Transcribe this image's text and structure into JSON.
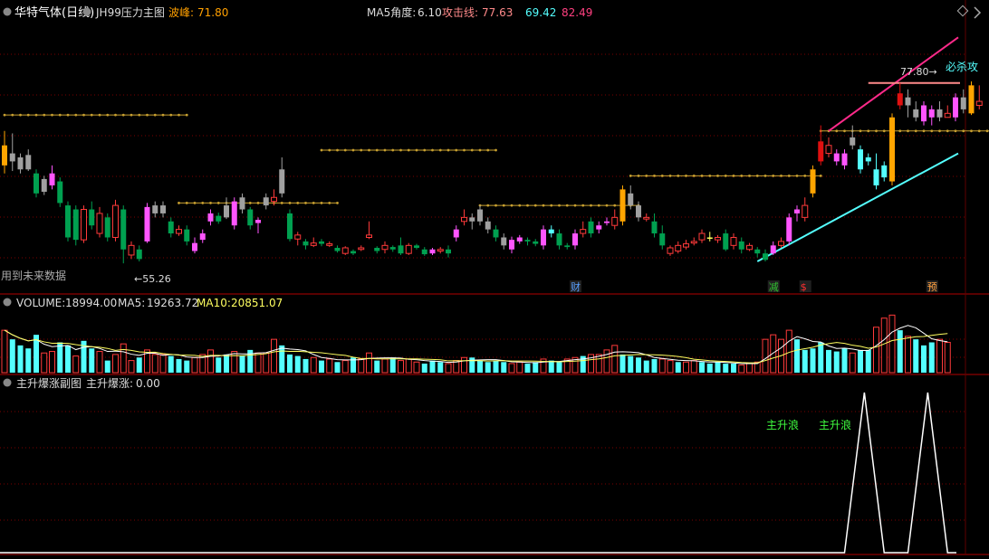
{
  "colors": {
    "up": "#ff3a3a",
    "down": "#00a050",
    "pink": "#ff55ff",
    "gray": "#a0a0a0",
    "cyan": "#54ffff",
    "orange": "#ffa500",
    "gold": "#c8a030",
    "grid": "#7a0000",
    "yellow": "#ffff60",
    "white": "#ffffff",
    "magenta": "#ff2a8a",
    "salmon": "#ff8a8a"
  },
  "main_panel": {
    "title_name": "华特气体(日线)",
    "indicator_name": "JH99压力主图",
    "wave_peak_label": "波峰:",
    "wave_peak_value": "71.80",
    "ma5_angle_label": "MA5角度:",
    "ma5_angle_value": "6.10",
    "attack_line_label": "攻击线:",
    "attack_line_value": "77.63",
    "value_2": "69.42",
    "value_3": "82.49",
    "future_note": "用到未来数据",
    "low_marker": "←55.26",
    "high_marker": "77.80→",
    "kill_signal": "必杀攻",
    "events": [
      {
        "text": "财",
        "index": 72,
        "color": "#5aa0ff"
      },
      {
        "text": "减",
        "index": 97,
        "color": "#30c030"
      },
      {
        "text": "$",
        "index": 101,
        "color": "#ff3030"
      },
      {
        "text": "预",
        "index": 117,
        "color": "#ffa040"
      }
    ]
  },
  "volume_panel": {
    "title": "VOLUME:",
    "value": "18994.00",
    "ma5_label": "MA5:",
    "ma5_value": "19263.72",
    "ma10_label": "MA10:",
    "ma10_value": "20851.07"
  },
  "sub_panel": {
    "title": "主升爆涨副图",
    "indicator_label": "主升爆涨:",
    "indicator_value": "0.00",
    "wave_labels": [
      "主升浪",
      "主升浪"
    ]
  },
  "chart_data": {
    "type": "candlestick",
    "note_colors": "g=gray, p=pink, u=red hollow up, d=green down, c=cyan, o=orange",
    "price_range": [
      52,
      85
    ],
    "candles": [
      [
        70.0,
        67.5,
        71.8,
        66.5,
        "o"
      ],
      [
        69.0,
        68.0,
        71.5,
        66.8,
        "g"
      ],
      [
        68.5,
        67.0,
        69.0,
        66.5,
        "g"
      ],
      [
        67.0,
        68.8,
        69.5,
        66.8,
        "g"
      ],
      [
        66.5,
        64.0,
        67.0,
        63.5,
        "d"
      ],
      [
        64.2,
        65.8,
        66.2,
        63.8,
        "g"
      ],
      [
        65.0,
        66.5,
        67.5,
        64.5,
        "p"
      ],
      [
        65.5,
        62.8,
        66.0,
        62.3,
        "d"
      ],
      [
        62.5,
        58.5,
        63.0,
        58.0,
        "d"
      ],
      [
        62.0,
        58.2,
        62.5,
        57.5,
        "d"
      ],
      [
        58.2,
        62.0,
        62.5,
        57.8,
        "u"
      ],
      [
        62.0,
        60.0,
        63.0,
        59.5,
        "d"
      ],
      [
        59.0,
        61.5,
        62.3,
        58.5,
        "u"
      ],
      [
        61.0,
        58.5,
        61.5,
        58.0,
        "d"
      ],
      [
        58.5,
        62.5,
        63.2,
        58.0,
        "u"
      ],
      [
        62.0,
        57.0,
        62.5,
        55.26,
        "d"
      ],
      [
        56.3,
        57.5,
        58.0,
        55.8,
        "u"
      ],
      [
        57.0,
        55.8,
        57.5,
        55.5,
        "d"
      ],
      [
        58.0,
        62.3,
        62.8,
        57.8,
        "p"
      ],
      [
        62.5,
        61.5,
        63.0,
        61.0,
        "g"
      ],
      [
        61.5,
        62.5,
        63.0,
        61.0,
        "g"
      ],
      [
        60.5,
        59.0,
        61.0,
        58.5,
        "d"
      ],
      [
        59.0,
        59.5,
        60.0,
        58.7,
        "u"
      ],
      [
        59.5,
        58.0,
        60.0,
        57.5,
        "d"
      ],
      [
        56.8,
        57.8,
        58.5,
        56.5,
        "p"
      ],
      [
        58.2,
        59.0,
        59.5,
        57.8,
        "p"
      ],
      [
        60.5,
        61.5,
        62.0,
        60.0,
        "p"
      ],
      [
        61.2,
        60.5,
        61.6,
        60.2,
        "d"
      ],
      [
        61.0,
        62.5,
        63.5,
        60.8,
        "g"
      ],
      [
        60.0,
        63.0,
        63.5,
        59.5,
        "p"
      ],
      [
        63.5,
        62.0,
        64.0,
        61.5,
        "g"
      ],
      [
        62.0,
        60.0,
        62.3,
        59.5,
        "d"
      ],
      [
        60.3,
        60.7,
        61.0,
        59.0,
        "p"
      ],
      [
        62.5,
        63.5,
        64.0,
        62.0,
        "g"
      ],
      [
        63.5,
        63.0,
        64.5,
        62.5,
        "u"
      ],
      [
        64.0,
        67.0,
        68.5,
        63.5,
        "g"
      ],
      [
        61.5,
        58.3,
        62.0,
        58.0,
        "d"
      ],
      [
        58.3,
        58.8,
        59.2,
        57.5,
        "u"
      ],
      [
        58.0,
        57.5,
        58.3,
        57.0,
        "d"
      ],
      [
        57.5,
        57.8,
        58.5,
        57.3,
        "u"
      ],
      [
        58.0,
        57.7,
        58.3,
        57.4,
        "d"
      ],
      [
        57.5,
        57.7,
        58.0,
        57.3,
        "u"
      ],
      [
        57.2,
        56.8,
        57.5,
        56.6,
        "d"
      ],
      [
        56.5,
        57.2,
        57.4,
        56.3,
        "u"
      ],
      [
        56.8,
        56.5,
        57.0,
        56.3,
        "d"
      ],
      [
        57.0,
        57.2,
        57.5,
        56.8,
        "u"
      ],
      [
        58.5,
        58.8,
        60.5,
        58.3,
        "u"
      ],
      [
        57.2,
        56.8,
        57.4,
        56.5,
        "d"
      ],
      [
        57.0,
        57.5,
        58.0,
        56.5,
        "u"
      ],
      [
        57.3,
        57.0,
        57.5,
        56.7,
        "d"
      ],
      [
        57.5,
        56.5,
        58.5,
        56.3,
        "d"
      ],
      [
        56.5,
        57.5,
        57.8,
        56.3,
        "u"
      ],
      [
        57.5,
        57.2,
        57.7,
        57.0,
        "d"
      ],
      [
        57.0,
        56.4,
        57.3,
        56.2,
        "d"
      ],
      [
        56.5,
        57.0,
        57.2,
        56.3,
        "p"
      ],
      [
        57.0,
        56.8,
        57.3,
        56.5,
        "u"
      ],
      [
        57.0,
        56.5,
        57.5,
        56.0,
        "d"
      ],
      [
        58.5,
        59.5,
        60.0,
        58.0,
        "p"
      ],
      [
        60.5,
        61.0,
        62.0,
        60.0,
        "u"
      ],
      [
        61.0,
        60.5,
        61.5,
        59.5,
        "g"
      ],
      [
        62.0,
        60.5,
        62.5,
        60.0,
        "g"
      ],
      [
        60.5,
        59.5,
        61.0,
        59.0,
        "g"
      ],
      [
        59.5,
        58.5,
        60.0,
        58.0,
        "d"
      ],
      [
        58.5,
        57.5,
        59.0,
        57.0,
        "g"
      ],
      [
        57.0,
        58.2,
        58.6,
        56.5,
        "p"
      ],
      [
        58.0,
        58.5,
        58.8,
        57.7,
        "p"
      ],
      [
        58.2,
        58.0,
        58.5,
        57.5,
        "d"
      ],
      [
        58.0,
        57.7,
        58.3,
        57.4,
        "d"
      ],
      [
        57.5,
        59.5,
        60.0,
        57.0,
        "p"
      ],
      [
        59.5,
        59.0,
        60.0,
        58.5,
        "c"
      ],
      [
        59.0,
        57.5,
        59.5,
        57.0,
        "d"
      ],
      [
        57.5,
        57.3,
        57.8,
        57.0,
        "d"
      ],
      [
        57.5,
        59.0,
        59.5,
        57.0,
        "p"
      ],
      [
        59.0,
        59.5,
        60.5,
        58.5,
        "u"
      ],
      [
        60.5,
        59.0,
        61.0,
        58.5,
        "d"
      ],
      [
        59.5,
        60.0,
        60.5,
        59.0,
        "p"
      ],
      [
        60.3,
        60.5,
        61.0,
        60.0,
        "p"
      ],
      [
        60.0,
        61.0,
        62.0,
        59.5,
        "u"
      ],
      [
        60.5,
        64.5,
        65.0,
        60.0,
        "o"
      ],
      [
        64.0,
        62.5,
        65.0,
        62.0,
        "g"
      ],
      [
        62.5,
        61.0,
        63.0,
        60.5,
        "g"
      ],
      [
        61.0,
        60.8,
        61.5,
        60.5,
        "u"
      ],
      [
        60.5,
        59.0,
        61.5,
        58.5,
        "d"
      ],
      [
        59.0,
        57.5,
        60.0,
        57.0,
        "d"
      ],
      [
        56.5,
        57.2,
        57.5,
        56.2,
        "u"
      ],
      [
        56.8,
        57.5,
        58.0,
        56.5,
        "u"
      ],
      [
        57.3,
        57.7,
        58.2,
        57.0,
        "u"
      ],
      [
        57.8,
        58.0,
        58.5,
        57.5,
        "u"
      ],
      [
        58.2,
        59.0,
        59.5,
        57.8,
        "u"
      ],
      [
        58.5,
        58.5,
        59.2,
        58.0,
        "yellow"
      ],
      [
        58.5,
        58.2,
        58.8,
        57.8,
        "u"
      ],
      [
        59.0,
        57.0,
        59.5,
        56.8,
        "d"
      ],
      [
        57.5,
        58.5,
        59.0,
        57.0,
        "u"
      ],
      [
        58.0,
        57.0,
        58.5,
        56.5,
        "d"
      ],
      [
        57.0,
        57.5,
        57.8,
        56.8,
        "u"
      ],
      [
        57.0,
        56.5,
        57.3,
        56.0,
        "d"
      ],
      [
        56.5,
        55.7,
        57.0,
        55.5,
        "d"
      ],
      [
        56.5,
        57.5,
        58.0,
        56.3,
        "p"
      ],
      [
        57.5,
        58.0,
        58.5,
        57.2,
        "u"
      ],
      [
        58.0,
        61.0,
        61.5,
        57.5,
        "p"
      ],
      [
        61.5,
        62.0,
        62.5,
        60.5,
        "p"
      ],
      [
        62.5,
        61.0,
        63.5,
        60.5,
        "u"
      ],
      [
        64.0,
        67.0,
        67.5,
        63.5,
        "o"
      ],
      [
        70.5,
        68.0,
        72.5,
        67.5,
        "up-fill"
      ],
      [
        69.0,
        70.0,
        71.0,
        68.5,
        "u"
      ],
      [
        68.0,
        69.0,
        69.5,
        67.5,
        "p"
      ],
      [
        69.0,
        67.5,
        69.5,
        67.0,
        "p"
      ],
      [
        70.0,
        71.0,
        72.5,
        69.5,
        "g"
      ],
      [
        69.5,
        67.0,
        70.0,
        66.5,
        "c"
      ],
      [
        68.0,
        68.5,
        69.0,
        67.5,
        "c"
      ],
      [
        67.0,
        65.0,
        69.0,
        64.5,
        "c"
      ],
      [
        66.0,
        67.5,
        68.0,
        65.5,
        "c"
      ],
      [
        65.5,
        73.5,
        74.0,
        65.0,
        "o"
      ],
      [
        76.5,
        75.0,
        77.8,
        74.5,
        "up-fill"
      ],
      [
        75.0,
        76.0,
        77.0,
        73.5,
        "g"
      ],
      [
        74.5,
        73.5,
        75.5,
        73.0,
        "g"
      ],
      [
        73.0,
        75.0,
        75.5,
        72.5,
        "p"
      ],
      [
        73.5,
        74.5,
        75.0,
        72.5,
        "p"
      ],
      [
        74.5,
        73.5,
        75.5,
        73.0,
        "g"
      ],
      [
        73.5,
        74.0,
        75.0,
        73.5,
        "u"
      ],
      [
        73.5,
        76.0,
        76.5,
        73.0,
        "p"
      ],
      [
        76.0,
        74.5,
        77.0,
        74.0,
        "g"
      ],
      [
        74.0,
        77.5,
        78.0,
        73.8,
        "o"
      ],
      [
        75.5,
        75.0,
        77.5,
        74.5,
        "u"
      ]
    ],
    "volume": [
      [
        28,
        "u"
      ],
      [
        22,
        "c"
      ],
      [
        18,
        "c"
      ],
      [
        16,
        "c"
      ],
      [
        25,
        "c"
      ],
      [
        13,
        "u"
      ],
      [
        14,
        "u"
      ],
      [
        20,
        "c"
      ],
      [
        18,
        "c"
      ],
      [
        11,
        "u"
      ],
      [
        21,
        "c"
      ],
      [
        16,
        "c"
      ],
      [
        14,
        "u"
      ],
      [
        8,
        "c"
      ],
      [
        12,
        "u"
      ],
      [
        19,
        "u"
      ],
      [
        8,
        "u"
      ],
      [
        10,
        "c"
      ],
      [
        15,
        "u"
      ],
      [
        12,
        "u"
      ],
      [
        12,
        "u"
      ],
      [
        11,
        "c"
      ],
      [
        9,
        "c"
      ],
      [
        8,
        "c"
      ],
      [
        10,
        "u"
      ],
      [
        12,
        "u"
      ],
      [
        15,
        "u"
      ],
      [
        10,
        "c"
      ],
      [
        12,
        "c"
      ],
      [
        14,
        "u"
      ],
      [
        11,
        "c"
      ],
      [
        15,
        "c"
      ],
      [
        13,
        "u"
      ],
      [
        13,
        "u"
      ],
      [
        22,
        "u"
      ],
      [
        18,
        "c"
      ],
      [
        12,
        "c"
      ],
      [
        11,
        "c"
      ],
      [
        9,
        "c"
      ],
      [
        10,
        "u"
      ],
      [
        8,
        "c"
      ],
      [
        9,
        "u"
      ],
      [
        7,
        "c"
      ],
      [
        8,
        "u"
      ],
      [
        10,
        "c"
      ],
      [
        9,
        "u"
      ],
      [
        13,
        "u"
      ],
      [
        8,
        "c"
      ],
      [
        9,
        "u"
      ],
      [
        10,
        "c"
      ],
      [
        8,
        "u"
      ],
      [
        9,
        "u"
      ],
      [
        7,
        "u"
      ],
      [
        6,
        "c"
      ],
      [
        8,
        "c"
      ],
      [
        7,
        "c"
      ],
      [
        6,
        "u"
      ],
      [
        8,
        "u"
      ],
      [
        10,
        "u"
      ],
      [
        10,
        "c"
      ],
      [
        8,
        "c"
      ],
      [
        7,
        "c"
      ],
      [
        8,
        "c"
      ],
      [
        7,
        "c"
      ],
      [
        6,
        "u"
      ],
      [
        7,
        "u"
      ],
      [
        6,
        "c"
      ],
      [
        7,
        "c"
      ],
      [
        9,
        "u"
      ],
      [
        8,
        "c"
      ],
      [
        7,
        "c"
      ],
      [
        9,
        "u"
      ],
      [
        10,
        "u"
      ],
      [
        11,
        "c"
      ],
      [
        12,
        "u"
      ],
      [
        12,
        "u"
      ],
      [
        15,
        "u"
      ],
      [
        18,
        "u"
      ],
      [
        12,
        "c"
      ],
      [
        11,
        "c"
      ],
      [
        10,
        "c"
      ],
      [
        8,
        "c"
      ],
      [
        9,
        "c"
      ],
      [
        9,
        "u"
      ],
      [
        8,
        "u"
      ],
      [
        7,
        "c"
      ],
      [
        7,
        "u"
      ],
      [
        8,
        "u"
      ],
      [
        7,
        "c"
      ],
      [
        6,
        "c"
      ],
      [
        7,
        "c"
      ],
      [
        6,
        "c"
      ],
      [
        6,
        "c"
      ],
      [
        5,
        "u"
      ],
      [
        6,
        "u"
      ],
      [
        7,
        "u"
      ],
      [
        22,
        "u"
      ],
      [
        25,
        "u"
      ],
      [
        22,
        "u"
      ],
      [
        28,
        "u"
      ],
      [
        22,
        "c"
      ],
      [
        15,
        "c"
      ],
      [
        16,
        "c"
      ],
      [
        20,
        "c"
      ],
      [
        15,
        "c"
      ],
      [
        14,
        "c"
      ],
      [
        16,
        "c"
      ],
      [
        13,
        "u"
      ],
      [
        15,
        "c"
      ],
      [
        15,
        "c"
      ],
      [
        30,
        "u"
      ],
      [
        36,
        "u"
      ],
      [
        38,
        "u"
      ],
      [
        28,
        "c"
      ],
      [
        24,
        "u"
      ],
      [
        22,
        "c"
      ],
      [
        18,
        "c"
      ],
      [
        20,
        "c"
      ],
      [
        22,
        "u"
      ],
      [
        20,
        "u"
      ]
    ],
    "subplot_spikes": [
      {
        "start": 106,
        "peak": 108.5,
        "end": 111
      },
      {
        "start": 114,
        "peak": 116.5,
        "end": 119
      }
    ],
    "resistance_lines": [
      {
        "from": 0,
        "to": 23,
        "price": 73.8
      },
      {
        "from": 22,
        "to": 42,
        "price": 62.8
      },
      {
        "from": 40,
        "to": 62,
        "price": 69.4
      },
      {
        "from": 60,
        "to": 80,
        "price": 62.5
      },
      {
        "from": 79,
        "to": 103,
        "price": 66.2
      },
      {
        "from": 103,
        "to": 136,
        "price": 71.8
      }
    ],
    "trend_lines": [
      {
        "color": "magenta",
        "from": [
          104,
          71.8
        ],
        "to": [
          137,
          83.5
        ]
      },
      {
        "color": "cyan",
        "from": [
          95,
          55.5
        ],
        "to": [
          137,
          69.0
        ]
      }
    ],
    "high_line_price": 77.8
  }
}
